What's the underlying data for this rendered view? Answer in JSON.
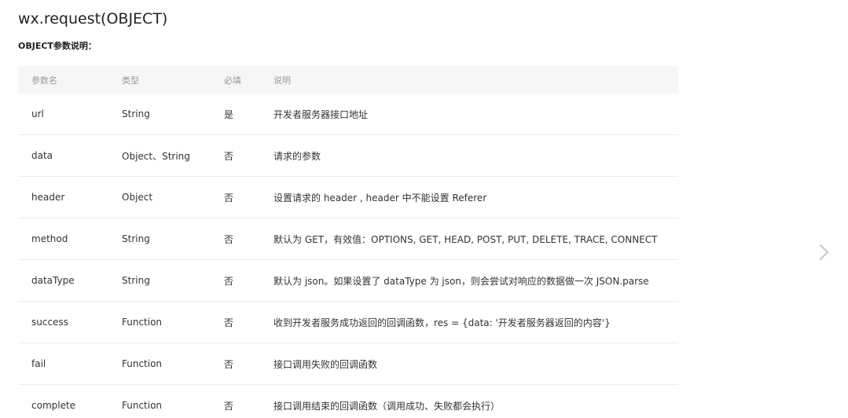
{
  "title": "wx.request(OBJECT)",
  "subtitle": "OBJECT参数说明：",
  "table": {
    "headers": [
      "参数名",
      "类型",
      "必填",
      "说明"
    ],
    "rows": [
      [
        "url",
        "String",
        "是",
        "开发者服务器接口地址"
      ],
      [
        "data",
        "Object、String",
        "否",
        "请求的参数"
      ],
      [
        "header",
        "Object",
        "否",
        "设置请求的 header , header 中不能设置 Referer"
      ],
      [
        "method",
        "String",
        "否",
        "默认为 GET，有效值：OPTIONS, GET, HEAD, POST, PUT, DELETE, TRACE, CONNECT"
      ],
      [
        "dataType",
        "String",
        "否",
        "默认为 json。如果设置了 dataType 为 json，则会尝试对响应的数据做一次 JSON.parse"
      ],
      [
        "success",
        "Function",
        "否",
        "收到开发者服务成功返回的回调函数，res = {data: '开发者服务器返回的内容'}"
      ],
      [
        "fail",
        "Function",
        "否",
        "接口调用失败的回调函数"
      ],
      [
        "complete",
        "Function",
        "否",
        "接口调用结束的回调函数（调用成功、失败都会执行）"
      ]
    ]
  },
  "icons": {
    "next": "chevron-right-icon"
  },
  "colors": {
    "header_bg": "#f6f6f6",
    "header_text": "#9a9a9a",
    "row_border": "#ececec",
    "chevron": "#c8c8c8"
  }
}
